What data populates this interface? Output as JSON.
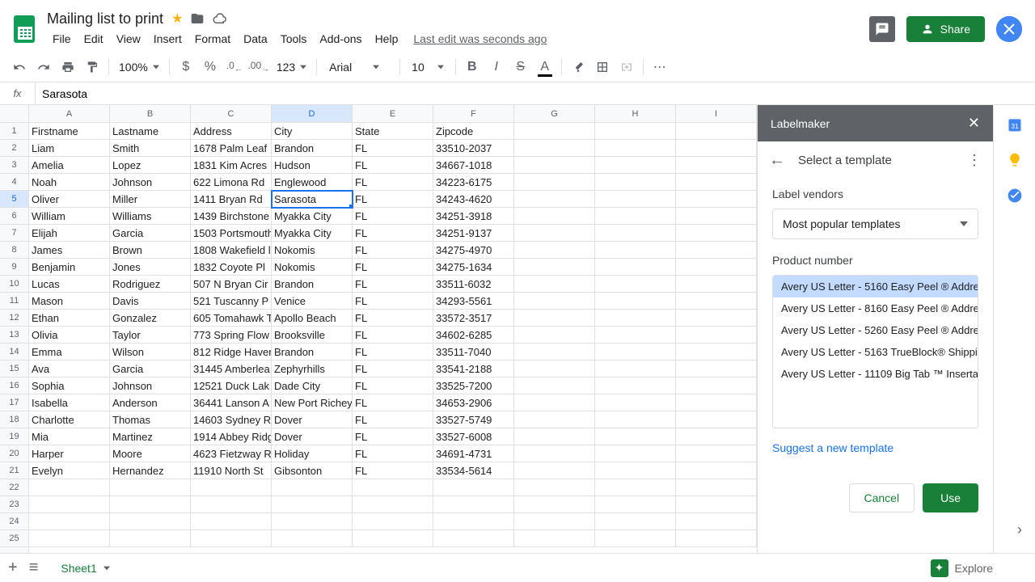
{
  "doc_title": "Mailing list to print",
  "last_edit": "Last edit was seconds ago",
  "share_label": "Share",
  "menus": [
    "File",
    "Edit",
    "View",
    "Insert",
    "Format",
    "Data",
    "Tools",
    "Add-ons",
    "Help"
  ],
  "toolbar": {
    "zoom": "100%",
    "font": "Arial",
    "font_size": "10",
    "num_format": "123"
  },
  "formula_value": "Sarasota",
  "columns": [
    "A",
    "B",
    "C",
    "D",
    "E",
    "F",
    "G",
    "H",
    "I"
  ],
  "active_col": "D",
  "active_row": 5,
  "headers": [
    "Firstname",
    "Lastname",
    "Address",
    "City",
    "State",
    "Zipcode"
  ],
  "rows": [
    [
      "Liam",
      "Smith",
      "1678 Palm Leaf",
      "Brandon",
      "FL",
      "33510-2037"
    ],
    [
      "Amelia",
      "Lopez",
      "1831 Kim Acres",
      "Hudson",
      "FL",
      "34667-1018"
    ],
    [
      "Noah",
      "Johnson",
      "622 Limona Rd",
      "Englewood",
      "FL",
      "34223-6175"
    ],
    [
      "Oliver",
      "Miller",
      "1411 Bryan Rd",
      "Sarasota",
      "FL",
      "34243-4620"
    ],
    [
      "William",
      "Williams",
      "1439 Birchstone",
      "Myakka City",
      "FL",
      "34251-3918"
    ],
    [
      "Elijah",
      "Garcia",
      "1503 Portsmouth",
      "Myakka City",
      "FL",
      "34251-9137"
    ],
    [
      "James",
      "Brown",
      "1808 Wakefield l",
      "Nokomis",
      "FL",
      "34275-4970"
    ],
    [
      "Benjamin",
      "Jones",
      "1832 Coyote Pl",
      "Nokomis",
      "FL",
      "34275-1634"
    ],
    [
      "Lucas",
      "Rodriguez",
      "507 N Bryan Cir",
      "Brandon",
      "FL",
      "33511-6032"
    ],
    [
      "Mason",
      "Davis",
      "521 Tuscanny P",
      "Venice",
      "FL",
      "34293-5561"
    ],
    [
      "Ethan",
      "Gonzalez",
      "605 Tomahawk T",
      "Apollo Beach",
      "FL",
      "33572-3517"
    ],
    [
      "Olivia",
      "Taylor",
      "773 Spring Flow",
      "Brooksville",
      "FL",
      "34602-6285"
    ],
    [
      "Emma",
      "Wilson",
      "812 Ridge Haver",
      "Brandon",
      "FL",
      "33511-7040"
    ],
    [
      "Ava",
      "Garcia",
      "31445 Amberlea",
      "Zephyrhills",
      "FL",
      "33541-2188"
    ],
    [
      "Sophia",
      "Johnson",
      "12521 Duck Lak",
      "Dade City",
      "FL",
      "33525-7200"
    ],
    [
      "Isabella",
      "Anderson",
      "36441 Lanson A",
      "New Port Richey",
      "FL",
      "34653-2906"
    ],
    [
      "Charlotte",
      "Thomas",
      "14603 Sydney R",
      "Dover",
      "FL",
      "33527-5749"
    ],
    [
      "Mia",
      "Martinez",
      "1914 Abbey Ridg",
      "Dover",
      "FL",
      "33527-6008"
    ],
    [
      "Harper",
      "Moore",
      "4623 Fietzway R",
      "Holiday",
      "FL",
      "34691-4731"
    ],
    [
      "Evelyn",
      "Hernandez",
      "11910 North St",
      "Gibsonton",
      "FL",
      "33534-5614"
    ]
  ],
  "sheet_tab": "Sheet1",
  "explore_label": "Explore",
  "sidepanel": {
    "header": "Labelmaker",
    "title": "Select a template",
    "vendors_label": "Label vendors",
    "vendor_selected": "Most popular templates",
    "product_label": "Product number",
    "products": [
      "Avery US Letter - 5160 Easy Peel ® Addre",
      "Avery US Letter - 8160 Easy Peel ® Addre",
      "Avery US Letter - 5260 Easy Peel ® Addre",
      "Avery US Letter - 5163 TrueBlock® Shippi",
      "Avery US Letter - 11109 Big Tab ™ Inserta"
    ],
    "selected_idx": 0,
    "suggest_link": "Suggest a new template",
    "cancel": "Cancel",
    "use": "Use"
  }
}
